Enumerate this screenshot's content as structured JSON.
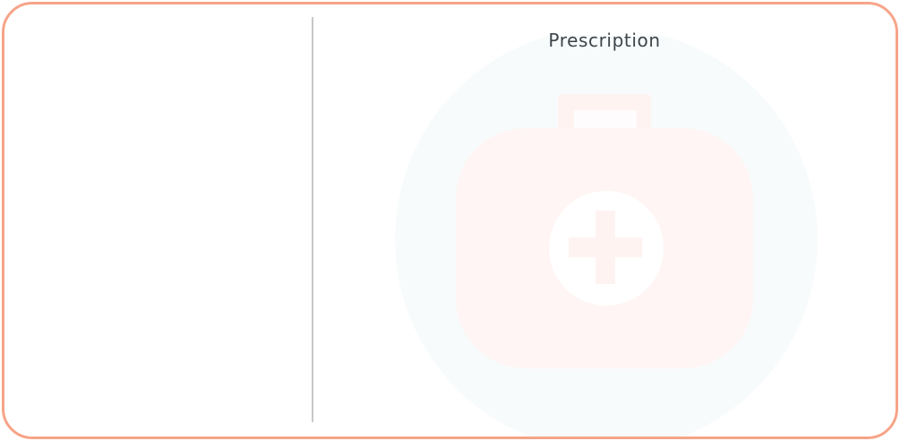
{
  "prescription_card": {
    "title": "Prescription"
  },
  "colors": {
    "border": "#f7a488",
    "divider": "#c7c7c7",
    "title_text": "#3d4549",
    "watermark_circle": "#f8fbfc",
    "watermark_kit": "#fff5f4"
  },
  "icons": {
    "watermark": "first-aid-kit-icon"
  }
}
